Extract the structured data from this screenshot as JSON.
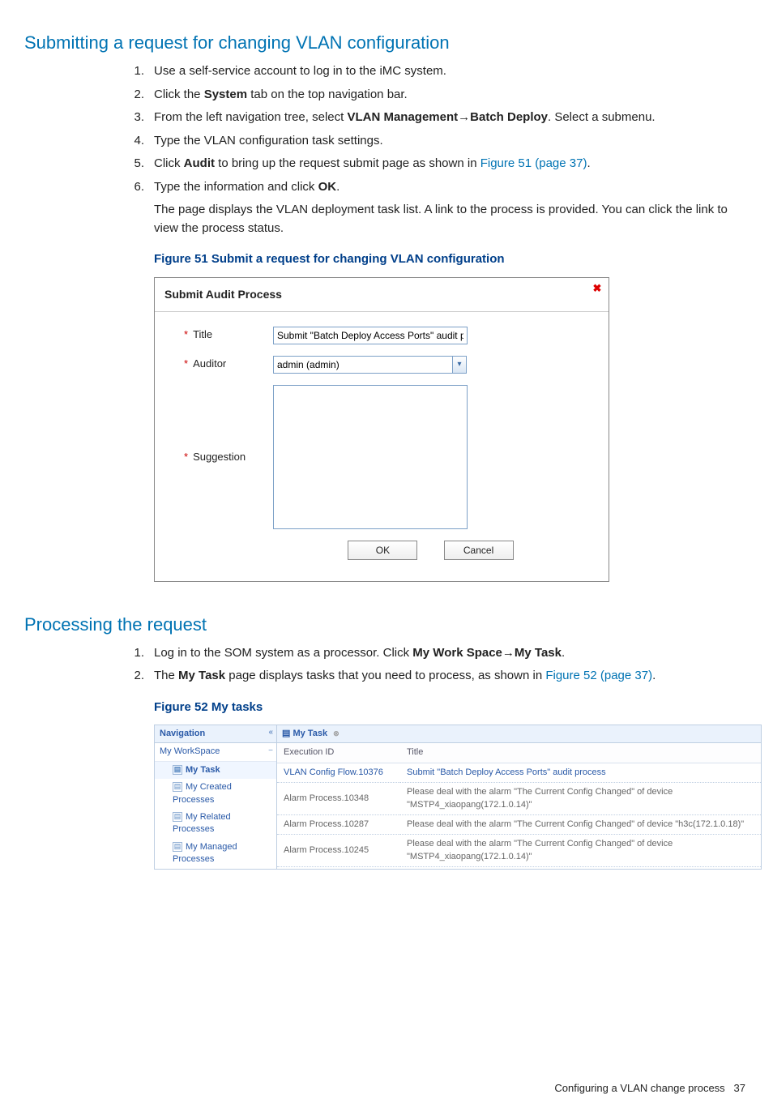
{
  "h1a": "Submitting a request for changing VLAN configuration",
  "steps_a": {
    "s1": "Use a self-service account to log in to the iMC system.",
    "s2a": "Click the ",
    "s2b": "System",
    "s2c": " tab on the top navigation bar.",
    "s3a": "From the left navigation tree, select ",
    "s3b": "VLAN Management",
    "s3c": "→",
    "s3d": "Batch Deploy",
    "s3e": ". Select a submenu.",
    "s4": "Type the VLAN configuration task settings.",
    "s5a": "Click ",
    "s5b": "Audit",
    "s5c": " to bring up the request submit page as shown in ",
    "s5d": "Figure 51 (page 37)",
    "s5e": ".",
    "s6a": "Type the information and click ",
    "s6b": "OK",
    "s6c": ".",
    "s6p": "The page displays the VLAN deployment task list. A link to the process is provided. You can click the link to view the process status."
  },
  "fig51_caption": "Figure 51 Submit a request for changing VLAN configuration",
  "fig51": {
    "dialog_title": "Submit Audit Process",
    "close": "✖",
    "label_title": "Title",
    "label_auditor": "Auditor",
    "label_suggestion": "Suggestion",
    "val_title": "Submit \"Batch Deploy Access Ports\" audit p",
    "val_auditor": "admin (admin)",
    "btn_ok": "OK",
    "btn_cancel": "Cancel"
  },
  "h1b": "Processing the request",
  "steps_b": {
    "s1a": "Log in to the SOM system as a processor. Click ",
    "s1b": "My Work Space",
    "s1c": "→",
    "s1d": "My Task",
    "s1e": ".",
    "s2a": "The ",
    "s2b": "My Task",
    "s2c": " page displays tasks that you need to process, as shown in ",
    "s2d": "Figure 52 (page 37)",
    "s2e": "."
  },
  "fig52_caption": "Figure 52 My tasks",
  "fig52": {
    "nav_title": "Navigation",
    "nav_group": "My WorkSpace",
    "nav_items": [
      "My Task",
      "My Created Processes",
      "My Related Processes",
      "My Managed Processes"
    ],
    "tab": "My Task",
    "col_exec": "Execution ID",
    "col_title": "Title",
    "rows": [
      {
        "exec": "VLAN Config Flow.10376",
        "title": "Submit \"Batch Deploy Access Ports\" audit process"
      },
      {
        "exec": "Alarm Process.10348",
        "title": "Please deal with the alarm \"The Current Config Changed\" of device \"MSTP4_xiaopang(172.1.0.14)\""
      },
      {
        "exec": "Alarm Process.10287",
        "title": "Please deal with the alarm \"The Current Config Changed\" of device \"h3c(172.1.0.18)\""
      },
      {
        "exec": "Alarm Process.10245",
        "title": "Please deal with the alarm \"The Current Config Changed\" of device \"MSTP4_xiaopang(172.1.0.14)\""
      }
    ]
  },
  "footer_a": "Configuring a VLAN change process",
  "footer_b": "37"
}
